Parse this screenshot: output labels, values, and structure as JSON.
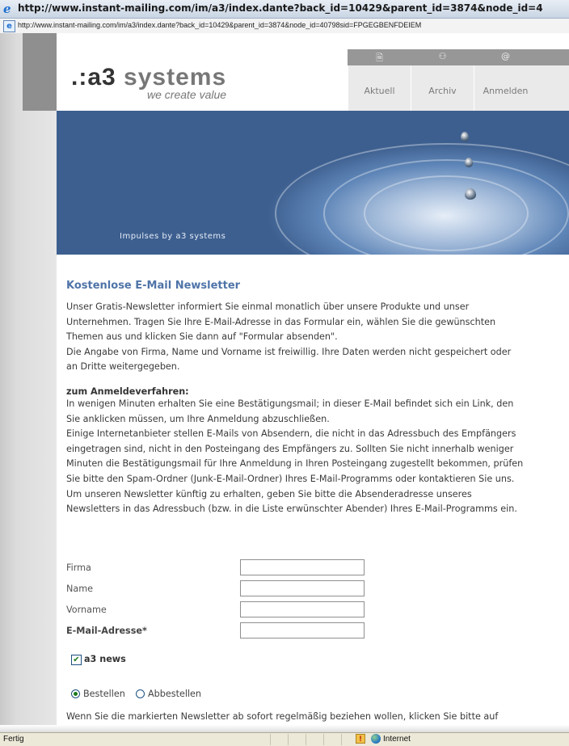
{
  "window": {
    "title": "http://www.instant-mailing.com/im/a3/index.dante?back_id=10429&parent_id=3874&node_id=4",
    "address": "http://www.instant-mailing.com/im/a3/index.dante?back_id=10429&parent_id=3874&node_id=40798sid=FPGEGBENFDEIEM"
  },
  "brand": {
    "logo_dots": ".:",
    "logo_a3": "a3",
    "logo_word": " systems",
    "tagline": "we create value",
    "accent_color": "#4f74a8"
  },
  "nav": {
    "items": [
      {
        "label": "Aktuell",
        "icon": "document-icon",
        "glyph": "🗎"
      },
      {
        "label": "Archiv",
        "icon": "binoculars-icon",
        "glyph": "⚇"
      },
      {
        "label": "Anmelden",
        "icon": "at-icon",
        "glyph": "@"
      }
    ]
  },
  "hero": {
    "caption": "Impulses by a3 systems"
  },
  "article": {
    "heading": "Kostenlose E-Mail Newsletter",
    "intro_lines": [
      "Unser Gratis-Newsletter informiert Sie einmal monatlich über unsere Produkte und unser",
      "Unternehmen. Tragen Sie Ihre E-Mail-Adresse in das Formular ein, wählen Sie die gewünschten",
      "Themen aus und klicken Sie dann auf \"Formular absenden\".",
      "Die Angabe von Firma, Name und Vorname ist freiwillig. Ihre Daten werden nicht gespeichert oder",
      "an Dritte weitergegeben."
    ],
    "procedure_heading": "zum Anmeldeverfahren:",
    "procedure_lines": [
      "In wenigen Minuten erhalten Sie eine Bestätigungsmail; in dieser E-Mail befindet sich ein Link, den",
      "Sie anklicken müssen, um Ihre Anmeldung abzuschließen.",
      "Einige Internetanbieter stellen E-Mails von Absendern, die nicht in das Adressbuch des Empfängers",
      "eingetragen sind, nicht in den Posteingang des Empfängers zu. Sollten Sie nicht innerhalb weniger",
      "Minuten die Bestätigungsmail für Ihre Anmeldung in Ihren Posteingang zugestellt bekommen, prüfen",
      "Sie bitte den Spam-Ordner (Junk-E-Mail-Ordner) Ihres E-Mail-Programms oder kontaktieren Sie uns.",
      "Um unseren Newsletter künftig zu erhalten, geben Sie bitte die Absenderadresse unseres",
      "Newsletters in das Adressbuch (bzw. in die Liste erwünschter Abender) Ihres E-Mail-Programms ein."
    ]
  },
  "form": {
    "fields": [
      {
        "label": "Firma",
        "value": ""
      },
      {
        "label": "Name",
        "value": ""
      },
      {
        "label": "Vorname",
        "value": ""
      },
      {
        "label": "E-Mail-Adresse*",
        "value": ""
      }
    ],
    "newsletter_checkbox": {
      "label": "a3 news",
      "checked": true
    },
    "radio_options": [
      {
        "label": "Bestellen",
        "selected": true
      },
      {
        "label": "Abbestellen",
        "selected": false
      }
    ],
    "footer_line": "Wenn Sie die markierten Newsletter ab sofort regelmäßig beziehen wollen, klicken Sie bitte auf"
  },
  "statusbar": {
    "status": "Fertig",
    "zone": "Internet"
  }
}
